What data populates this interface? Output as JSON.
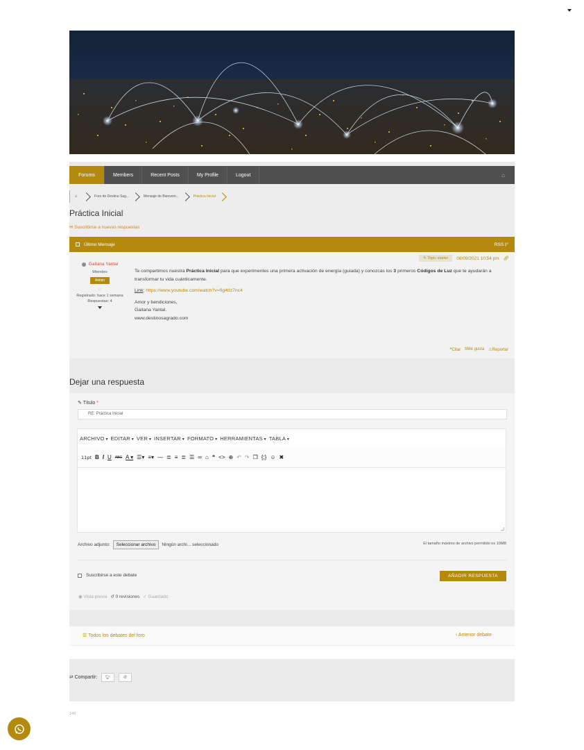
{
  "nav": {
    "items": [
      "Forums",
      "Members",
      "Recent Posts",
      "My Profile",
      "Logout"
    ],
    "active": "Forums"
  },
  "breadcrumb": [
    "Foro de Destino Sag...",
    "Mensaje de Bienveni...",
    "Práctica Inicial"
  ],
  "page_title": "Práctica Inicial",
  "subscribe_link": "Suscribirse a nuevas respuestas",
  "post_header": {
    "title": "Último Mensaje",
    "rss": "RSS"
  },
  "post": {
    "topic_starter": "Topic starter",
    "date": "08/09/2021 10:54 pm",
    "author": {
      "name": "Gaitana Yantal",
      "role": "Miembro",
      "badge": "Admin",
      "registered": "Registrado: hace 1 semana",
      "replies": "Respuestas: 4"
    },
    "p1_a": "Te compartimos nuestra ",
    "p1_b": "Práctica Inicial",
    "p1_c": " para que experimentes una primera activación de energía (guiada) y conozcas los ",
    "p1_d": "3",
    "p1_e": " primeros ",
    "p1_f": "Códigos de Luz",
    "p1_g": " que te ayudarán a transformar tu vida cuánticamente.",
    "link_label": "Link",
    "link_url": "https://www.youtube.com/watch?v=fIg4tIz7nc4",
    "closing_1": "Amor y bendiciones,",
    "closing_2": "Gaitana Yantal.",
    "closing_3": "www.destinosagrado.com",
    "actions": [
      "Citar",
      "Me gusta",
      "Reportar"
    ]
  },
  "reply": {
    "heading": "Dejar una respuesta",
    "title_label": "Título",
    "title_value": "RE: Práctica Inicial",
    "menus": [
      "ARCHIVO",
      "EDITAR",
      "VER",
      "INSERTAR",
      "FORMATO",
      "HERRAMIENTAS",
      "TABLA"
    ],
    "font_size": "11pt",
    "attach_label": "Archivo adjunto:",
    "attach_button": "Seleccionar archivo",
    "attach_status": "Ningún archi... seleccionado",
    "max_size": "El tamaño máximo de archivo permitido es 10MB",
    "subscribe": "Suscribirse a este debate",
    "submit": "AÑADIR RESPUESTA",
    "preview": "Vista previa",
    "revisions": "0 revisiones",
    "saved": "Guardado"
  },
  "topic_nav": {
    "all": "Todos los debates del foro",
    "prev": "Anterior debate"
  },
  "share_label": "Compartir:",
  "footer_number": "149",
  "colors": {
    "accent": "#b38a0e",
    "nav_bg": "#505050",
    "author_name": "#d84a3a"
  }
}
